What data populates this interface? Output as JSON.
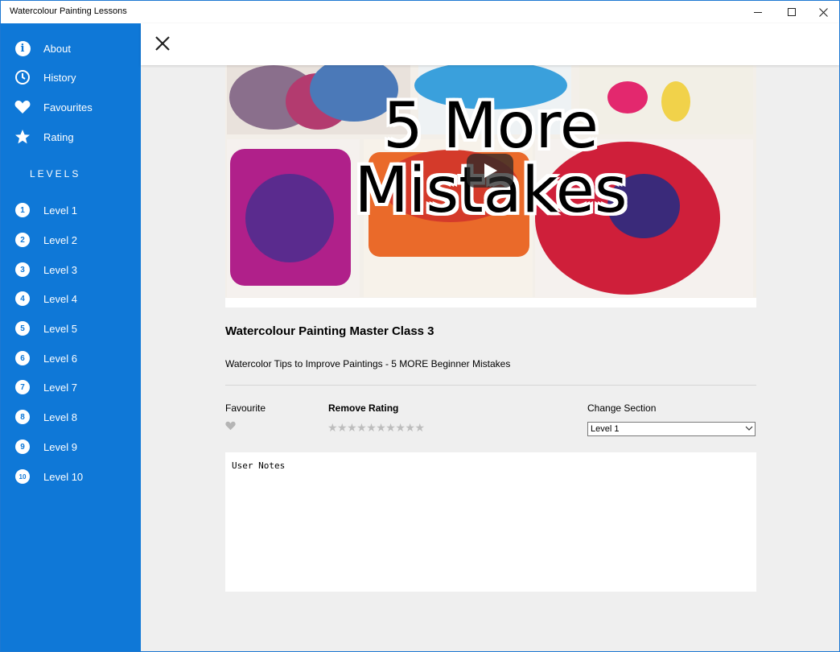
{
  "window": {
    "title": "Watercolour Painting Lessons"
  },
  "sidebar": {
    "items": [
      {
        "label": "About",
        "icon": "info-icon"
      },
      {
        "label": "History",
        "icon": "clock-icon"
      },
      {
        "label": "Favourites",
        "icon": "heart-icon"
      },
      {
        "label": "Rating",
        "icon": "star-icon"
      }
    ],
    "levels_header": "LEVELS",
    "levels": [
      {
        "num": "1",
        "label": "Level 1"
      },
      {
        "num": "2",
        "label": "Level 2"
      },
      {
        "num": "3",
        "label": "Level 3"
      },
      {
        "num": "4",
        "label": "Level 4"
      },
      {
        "num": "5",
        "label": "Level 5"
      },
      {
        "num": "6",
        "label": "Level 6"
      },
      {
        "num": "7",
        "label": "Level 7"
      },
      {
        "num": "8",
        "label": "Level 8"
      },
      {
        "num": "9",
        "label": "Level 9"
      },
      {
        "num": "10",
        "label": "Level 10"
      }
    ]
  },
  "video": {
    "overlay_line1": "5 More",
    "overlay_line2": "Mistakes"
  },
  "lesson": {
    "title": "Watercolour Painting Master Class 3",
    "description": "Watercolor Tips to Improve Paintings - 5 MORE Beginner Mistakes"
  },
  "controls": {
    "favourite_label": "Favourite",
    "remove_rating_label": "Remove Rating",
    "stars": "★★★★★★★★★★",
    "star_count": 10,
    "rating_value": 0,
    "change_section_label": "Change Section",
    "section_selected": "Level 1"
  },
  "notes": {
    "text": "User Notes"
  },
  "colors": {
    "accent": "#0f78d7",
    "content_bg": "#efefef"
  }
}
